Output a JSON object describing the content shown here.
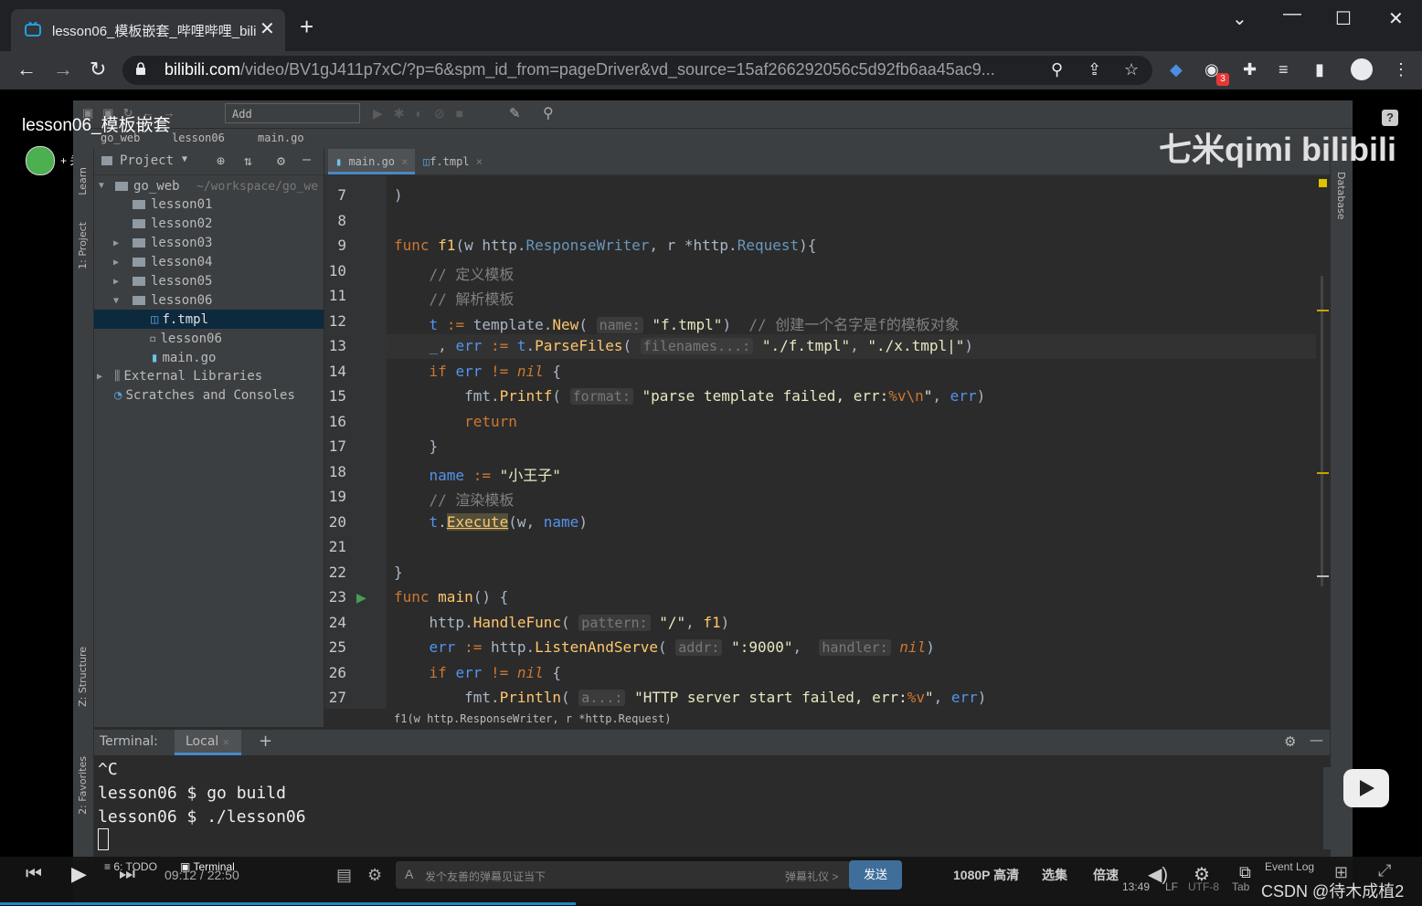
{
  "browser": {
    "tab_title": "lesson06_模板嵌套_哔哩哔哩_bili",
    "url_host": "bilibili.com",
    "url_path": "/video/BV1gJ411p7xC/?p=6&spm_id_from=pageDriver&vd_source=15af266292056c5d92fb6aa45ac9...",
    "extension_badge": "3"
  },
  "video": {
    "title": "lesson06_模板嵌套",
    "follow": "+ 关注",
    "watermark": "七米qimi bilibili"
  },
  "ide": {
    "add_config": "Add Configuration...",
    "breadcrumb": [
      "go_web",
      "lesson06",
      "main.go"
    ],
    "project_label": "Project",
    "left_strip": {
      "project": "1: Project",
      "structure": "Z: Structure",
      "favorites": "2: Favorites",
      "learn": "Learn"
    },
    "right_strip": {
      "database": "Database"
    },
    "tree": [
      {
        "label": "go_web",
        "extra": "~/workspace/go_we"
      },
      {
        "label": "lesson01"
      },
      {
        "label": "lesson02"
      },
      {
        "label": "lesson03"
      },
      {
        "label": "lesson04"
      },
      {
        "label": "lesson05"
      },
      {
        "label": "lesson06"
      },
      {
        "label": "f.tmpl"
      },
      {
        "label": "lesson06"
      },
      {
        "label": "main.go"
      },
      {
        "label": "External Libraries"
      },
      {
        "label": "Scratches and Consoles"
      }
    ],
    "tabs": [
      "main.go",
      "f.tmpl"
    ],
    "line_numbers": [
      "7",
      "8",
      "9",
      "10",
      "11",
      "12",
      "13",
      "14",
      "15",
      "16",
      "17",
      "18",
      "19",
      "20",
      "21",
      "22",
      "23",
      "24",
      "25",
      "26",
      "27"
    ],
    "signature": "f1(w http.ResponseWriter, r *http.Request)",
    "terminal": {
      "label": "Terminal:",
      "tab": "Local",
      "lines": [
        "^C",
        "lesson06 $ go build",
        "lesson06 $ ./lesson06"
      ]
    },
    "bottom_tabs": [
      "6: TODO",
      "Terminal"
    ],
    "status": {
      "pos": "13:49",
      "sep": "LF",
      "enc": "UTF-8",
      "indent": "Tab",
      "event_log": "Event Log"
    }
  },
  "player": {
    "time": "09:12 / 22:50",
    "danmu_placeholder": "发个友善的弹幕见证当下",
    "danmu_etiquette": "弹幕礼仪 >",
    "send": "发送",
    "quality": "1080P 高清",
    "episodes": "选集",
    "speed": "倍速",
    "credit": "CSDN @待木成植2"
  }
}
